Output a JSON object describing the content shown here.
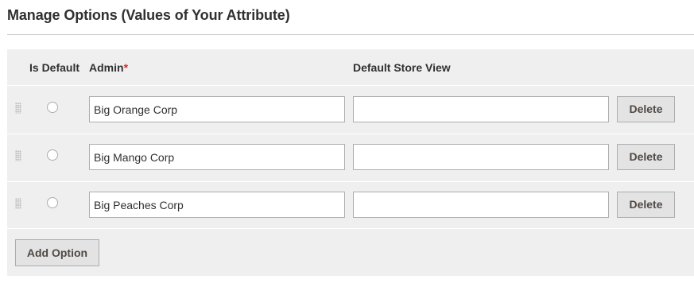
{
  "section": {
    "title": "Manage Options (Values of Your Attribute)"
  },
  "table": {
    "headers": {
      "is_default": "Is Default",
      "admin": "Admin",
      "required_marker": "*",
      "default_store_view": "Default Store View"
    },
    "rows": [
      {
        "is_default": false,
        "admin_value": "Big Orange Corp",
        "store_view_value": "",
        "delete_label": "Delete"
      },
      {
        "is_default": false,
        "admin_value": "Big Mango Corp",
        "store_view_value": "",
        "delete_label": "Delete"
      },
      {
        "is_default": false,
        "admin_value": "Big Peaches Corp",
        "store_view_value": "",
        "delete_label": "Delete"
      }
    ],
    "add_option_label": "Add Option"
  },
  "colors": {
    "panel_background": "#efefef",
    "button_background": "#e3e3e3",
    "required": "#e22626",
    "text": "#303030"
  }
}
